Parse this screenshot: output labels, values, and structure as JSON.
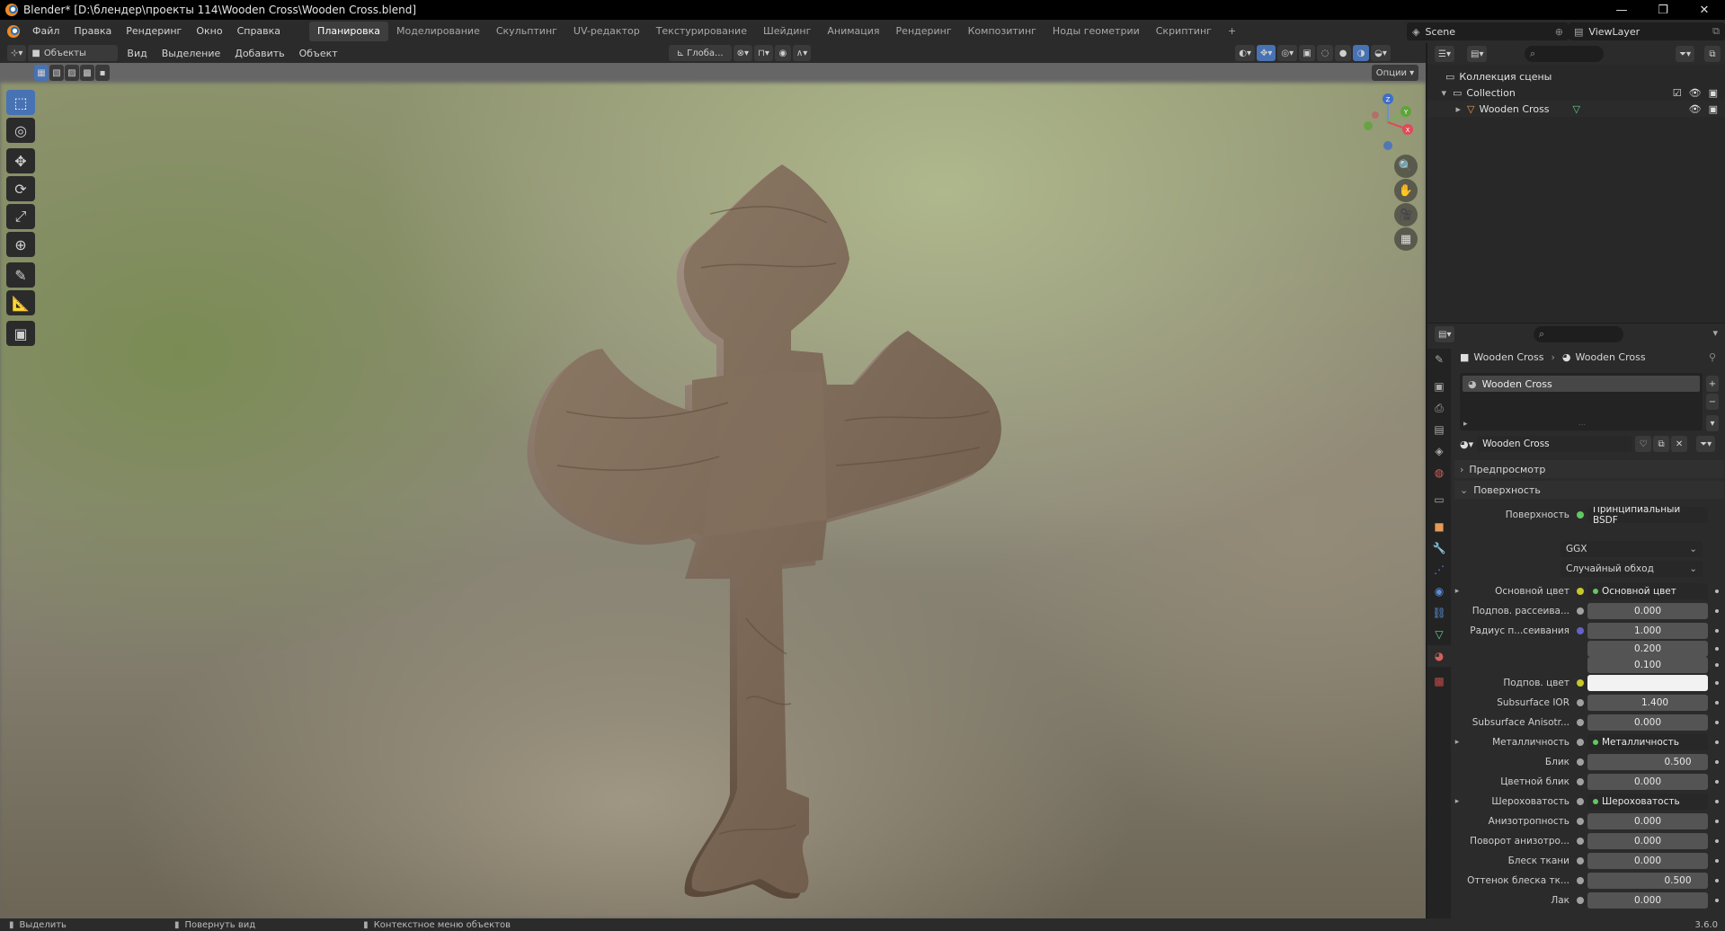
{
  "window": {
    "title": "Blender* [D:\\блендер\\проекты 114\\Wooden Cross\\Wooden Cross.blend]",
    "controls": [
      "—",
      "❐",
      "✕"
    ]
  },
  "menu": [
    "Файл",
    "Правка",
    "Рендеринг",
    "Окно",
    "Справка"
  ],
  "workspaces": {
    "tabs": [
      "Планировка",
      "Моделирование",
      "Скульптинг",
      "UV-редактор",
      "Текстурирование",
      "Шейдинг",
      "Анимация",
      "Рендеринг",
      "Композитинг",
      "Ноды геометрии",
      "Скриптинг"
    ],
    "active": "Планировка",
    "add": "+"
  },
  "scene": {
    "name": "Scene",
    "view_layer": "ViewLayer"
  },
  "viewport": {
    "mode": "Объекты",
    "menu": [
      "Вид",
      "Выделение",
      "Добавить",
      "Объект"
    ],
    "transform": "Глоба...",
    "options": "Опции",
    "object_name": "Wooden Cross",
    "gizmo": {
      "x": "X",
      "y": "Y",
      "z": "Z"
    }
  },
  "outliner": {
    "root": "Коллекция сцены",
    "collection": "Collection",
    "object": "Wooden Cross"
  },
  "properties": {
    "breadcrumb": [
      "Wooden Cross",
      "Wooden Cross"
    ],
    "slot": "Wooden Cross",
    "material": "Wooden Cross",
    "panels": {
      "preview": "Предпросмотр",
      "surface": "Поверхность"
    },
    "surface_label": "Поверхность",
    "surface_value": "Принципиальный BSDF",
    "distribution": "GGX",
    "subsurface_method": "Случайный обход",
    "rows": [
      {
        "label": "Основной цвет",
        "value": "Основной цвет",
        "kind": "link",
        "expand": true,
        "socket": "#c7c729"
      },
      {
        "label": "Подпов. рассеива...",
        "value": "0.000",
        "kind": "num",
        "fill": 0,
        "socket": "#a1a1a1"
      },
      {
        "label": "Радиус п...сеивания",
        "value": "1.000",
        "kind": "num",
        "fill": 0,
        "socket": "#6363c7"
      },
      {
        "label": "",
        "value": "0.200",
        "kind": "num",
        "fill": 0,
        "socket": ""
      },
      {
        "label": "",
        "value": "0.100",
        "kind": "num",
        "fill": 0,
        "socket": ""
      },
      {
        "label": "Подпов. цвет",
        "value": "",
        "kind": "color",
        "fill": 0,
        "socket": "#c7c729"
      },
      {
        "label": "Subsurface IOR",
        "value": "1.400",
        "kind": "num",
        "fill": 0.12,
        "socket": "#a1a1a1"
      },
      {
        "label": "Subsurface Anisotr...",
        "value": "0.000",
        "kind": "num",
        "fill": 0,
        "socket": "#a1a1a1"
      },
      {
        "label": "Металличность",
        "value": "Металличность",
        "kind": "link",
        "expand": true,
        "socket": "#a1a1a1"
      },
      {
        "label": "Блик",
        "value": "0.500",
        "kind": "num",
        "fill": 0.5,
        "socket": "#a1a1a1"
      },
      {
        "label": "Цветной блик",
        "value": "0.000",
        "kind": "num",
        "fill": 0,
        "socket": "#a1a1a1"
      },
      {
        "label": "Шероховатость",
        "value": "Шероховатость",
        "kind": "link",
        "expand": true,
        "socket": "#a1a1a1"
      },
      {
        "label": "Анизотропность",
        "value": "0.000",
        "kind": "num",
        "fill": 0,
        "socket": "#a1a1a1"
      },
      {
        "label": "Поворот анизотро...",
        "value": "0.000",
        "kind": "num",
        "fill": 0,
        "socket": "#a1a1a1"
      },
      {
        "label": "Блеск ткани",
        "value": "0.000",
        "kind": "num",
        "fill": 0,
        "socket": "#a1a1a1"
      },
      {
        "label": "Оттенок блеска тк...",
        "value": "0.500",
        "kind": "num",
        "fill": 0.5,
        "socket": "#a1a1a1"
      },
      {
        "label": "Лак",
        "value": "0.000",
        "kind": "num",
        "fill": 0,
        "socket": "#a1a1a1"
      }
    ]
  },
  "status": {
    "select": "Выделить",
    "rotate": "Повернуть вид",
    "context": "Контекстное меню объектов",
    "version": "3.6.0"
  }
}
